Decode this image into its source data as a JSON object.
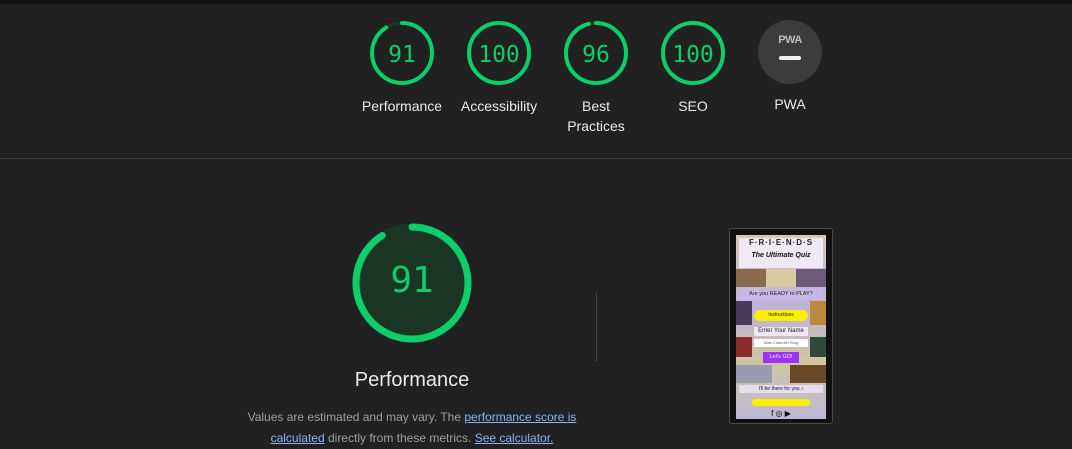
{
  "scores": [
    {
      "name": "performance",
      "value": "91",
      "label": "Performance",
      "fraction": 0.91
    },
    {
      "name": "accessibility",
      "value": "100",
      "label": "Accessibility",
      "fraction": 1.0
    },
    {
      "name": "best-practices",
      "value": "96",
      "label": "Best\nPractices",
      "fraction": 0.96
    },
    {
      "name": "seo",
      "value": "100",
      "label": "SEO",
      "fraction": 1.0
    }
  ],
  "pwa": {
    "badge_text": "PWA",
    "label": "PWA"
  },
  "detail": {
    "score": "91",
    "fraction": 0.91,
    "title": "Performance",
    "desc_prefix": "Values are estimated and may vary. The ",
    "link_score": "performance score is calculated",
    "desc_middle": " directly from these metrics. ",
    "link_calc": "See calculator."
  },
  "screenshot": {
    "logo": "F·R·I·E·N·D·S",
    "subtitle": "The Ultimate Quiz",
    "ready": "Are you READY to PLAY?",
    "instructions": "Instructions",
    "enter_name": "Enter Your Name",
    "input_placeholder": "Was Chandler Bing",
    "go": "Let's GO!",
    "here": "I'll be there for you ♪",
    "social": "f ◎ ▶"
  },
  "colors": {
    "pass": "#0cce6b",
    "pass_fill": "#1b3524",
    "background": "#212121"
  }
}
